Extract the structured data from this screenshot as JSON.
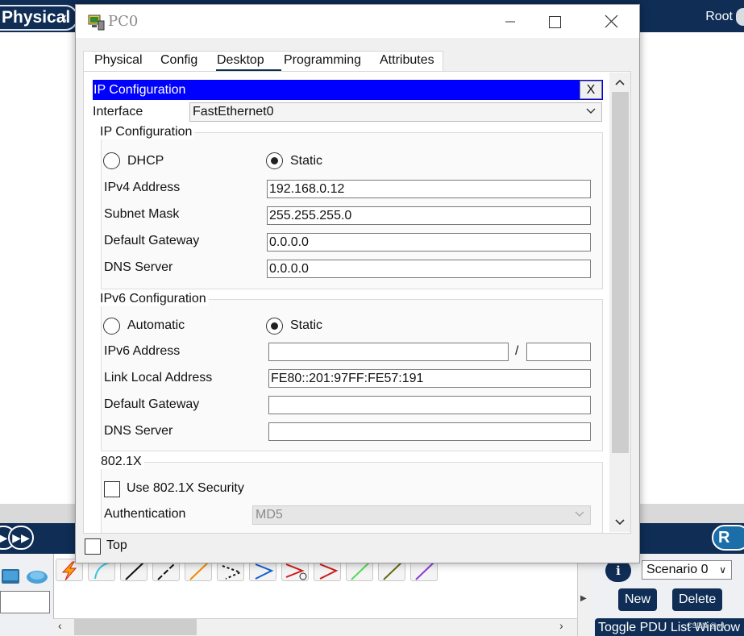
{
  "background": {
    "physical_tab": "Physical",
    "close_x": "x:",
    "root_label": "Root",
    "realtime_label": "R",
    "info_glyph": "i",
    "scenario": "Scenario 0",
    "new_button": "New",
    "delete_button": "Delete",
    "toggle_pdu": "Toggle PDU List Window",
    "watermark": "CSDN @ml"
  },
  "window": {
    "title": "PC0",
    "icon": "pc-monitor-icon",
    "controls": [
      "minimize-icon",
      "maximize-icon",
      "close-icon"
    ]
  },
  "tabs": [
    {
      "label": "Physical",
      "active": false
    },
    {
      "label": "Config",
      "active": false
    },
    {
      "label": "Desktop",
      "active": true
    },
    {
      "label": "Programming",
      "active": false
    },
    {
      "label": "Attributes",
      "active": false
    }
  ],
  "ip_config": {
    "header": "IP Configuration",
    "close_label": "X",
    "interface_label": "Interface",
    "interface_value": "FastEthernet0",
    "ipv4": {
      "group_title": "IP Configuration",
      "dhcp_label": "DHCP",
      "static_label": "Static",
      "mode": "static",
      "address_label": "IPv4 Address",
      "address_value": "192.168.0.12",
      "mask_label": "Subnet Mask",
      "mask_value": "255.255.255.0",
      "gateway_label": "Default Gateway",
      "gateway_value": "0.0.0.0",
      "dns_label": "DNS Server",
      "dns_value": "0.0.0.0"
    },
    "ipv6": {
      "group_title": "IPv6 Configuration",
      "auto_label": "Automatic",
      "static_label": "Static",
      "mode": "static",
      "address_label": "IPv6 Address",
      "address_value": "",
      "prefix_sep": "/",
      "prefix_value": "",
      "link_local_label": "Link Local Address",
      "link_local_value": "FE80::201:97FF:FE57:191",
      "gateway_label": "Default Gateway",
      "gateway_value": "",
      "dns_label": "DNS Server",
      "dns_value": ""
    },
    "dot1x": {
      "group_title": "802.1X",
      "use_label": "Use 802.1X Security",
      "checked": false,
      "auth_label": "Authentication",
      "auth_value": "MD5"
    }
  },
  "footer": {
    "top_label": "Top",
    "top_checked": false
  },
  "colors": {
    "title_bar_blue": "#0000ff",
    "app_navy": "#0f2d55",
    "tab_underline": "#0f2d55"
  }
}
